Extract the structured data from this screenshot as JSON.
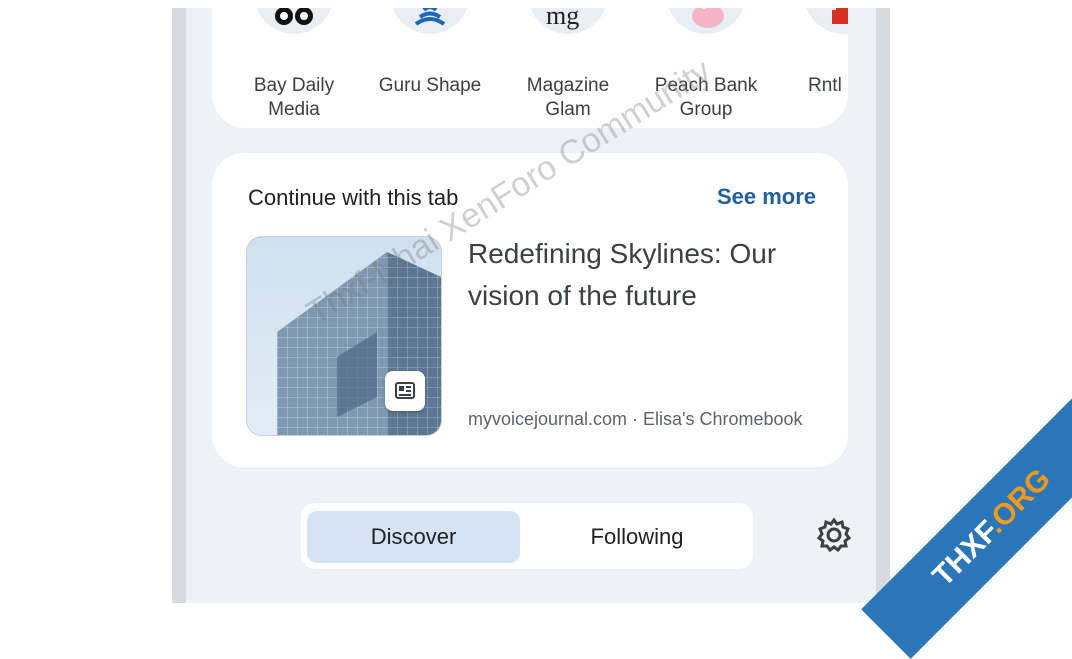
{
  "shortcuts": [
    {
      "label": "Bay Daily\nMedia",
      "icon": "owl-eyes-icon"
    },
    {
      "label": "Guru Shape",
      "icon": "yoga-figure-icon"
    },
    {
      "label": "Magazine\nGlam",
      "icon": "mg-logo-icon",
      "logo_text": "mg"
    },
    {
      "label": "Peach Bank\nGroup",
      "icon": "piggy-bank-icon"
    },
    {
      "label": "Rntl",
      "icon": "red-logo-icon"
    }
  ],
  "continue_tab": {
    "heading": "Continue with this tab",
    "see_more": "See more",
    "article_title": "Redefining Skylines: Our vision of the future",
    "meta": "myvoicejournal.com · Elisa's Chromebook",
    "badge_icon": "article-icon"
  },
  "feed_toggle": {
    "discover": "Discover",
    "following": "Following",
    "active": "Discover",
    "settings_icon": "gear-icon"
  },
  "watermark": {
    "text": "Thxf-Nhai XenForo Community",
    "ribbon_part1": "THXF",
    "ribbon_part2": ".ORG"
  },
  "colors": {
    "accent_link": "#1f5f9e",
    "active_segment": "#d6e3f5",
    "screen_bg": "#eef2f8"
  }
}
